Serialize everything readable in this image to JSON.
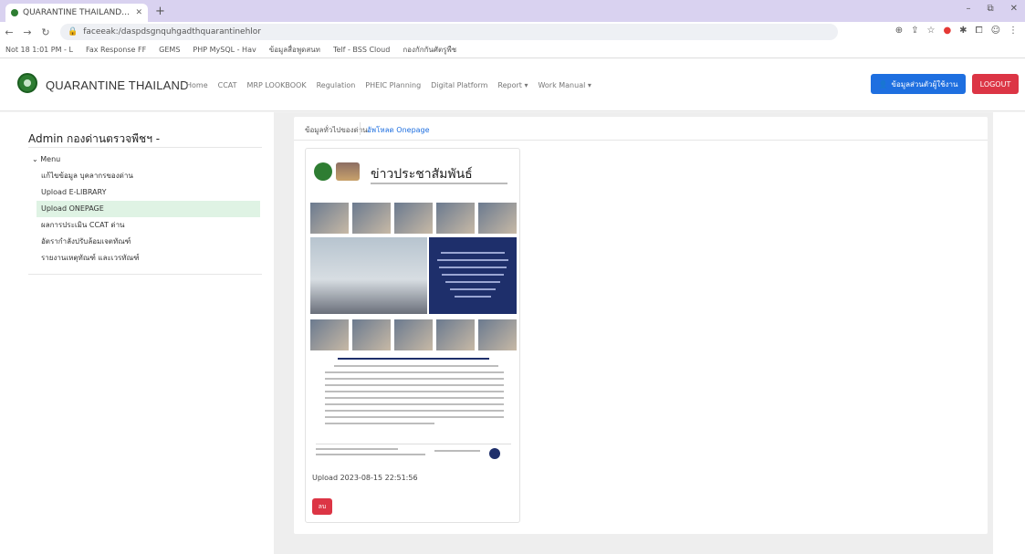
{
  "browser": {
    "tab_title": "QUARANTINE THAILAND - ADI",
    "new_tab_icon": "plus-icon",
    "window_controls": [
      "–",
      "⧉",
      "✕"
    ],
    "address": "faceeak:/daspdsgnquhgadthquarantinehlor",
    "bookmarks": [
      "Not 18 1:01 PM - L",
      "Fax Response FF",
      "GEMS",
      "PHP MySQL - Hav",
      "ข้อมูลสื่อพูดสนท",
      "Telf - BSS Cloud",
      "กองกักกันศัตรูพืช"
    ]
  },
  "app": {
    "brand": "QUARANTINE THAILAND",
    "menu": [
      "Home",
      "CCAT",
      "MRP LOOKBOOK",
      "Regulation",
      "PHEIC Planning",
      "Digital Platform",
      "Report ▾",
      "Work Manual ▾"
    ],
    "profile_button": "ข้อมูลส่วนตัวผู้ใช้งาน",
    "logout_button": "LOGOUT"
  },
  "sidebar": {
    "title": "Admin กองด่านตรวจพืชฯ -",
    "menu_head": "Menu",
    "items": [
      {
        "label": "แก้ไขข้อมูล บุคลากรของด่าน"
      },
      {
        "label": "Upload E-LIBRARY"
      },
      {
        "label": "Upload ONEPAGE"
      },
      {
        "label": "ผลการประเมิน CCAT ด่าน"
      },
      {
        "label": "อัตรากำลังปรับล้อมเจตทัณฑ์"
      },
      {
        "label": "รายงานเหตุทัณฑ์ และเวรทัณฑ์"
      }
    ]
  },
  "main": {
    "tabs": [
      "ข้อมูลทั่วไปของด่าน",
      "อัพโหลด Onepage"
    ],
    "post": {
      "poster_title": "ข่าวประชาสัมพันธ์",
      "upload_label": "Upload 2023-08-15 22:51:56",
      "delete_button": "ลบ"
    }
  }
}
